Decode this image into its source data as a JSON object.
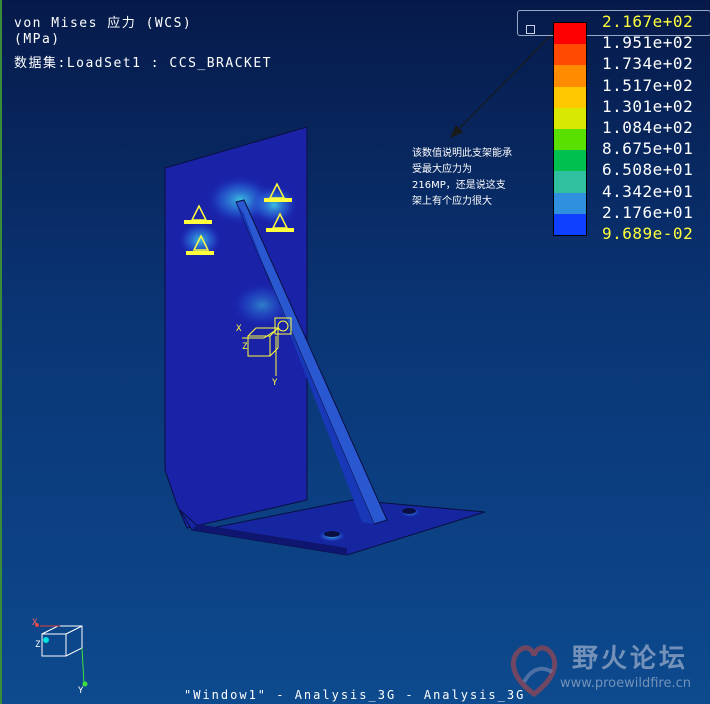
{
  "header": {
    "title": "von Mises 应力 (WCS)",
    "units": "(MPa)",
    "dataset": "数据集:LoadSet1 :  CCS_BRACKET"
  },
  "legend": {
    "values": [
      "2.167e+02",
      "1.951e+02",
      "1.734e+02",
      "1.517e+02",
      "1.301e+02",
      "1.084e+02",
      "8.675e+01",
      "6.508e+01",
      "4.342e+01",
      "2.176e+01",
      "9.689e-02"
    ],
    "colors": [
      "#ff0000",
      "#ff4a00",
      "#ff8c00",
      "#ffc800",
      "#d8e800",
      "#5ae000",
      "#00c050",
      "#30c0a0",
      "#3090e0",
      "#1040ff",
      "#101ca0"
    ]
  },
  "annotation": "该数值说明此支架能承受最大应力为216MP，还是说这支架上有个应力很大",
  "triad_main": {
    "x": "X",
    "y": "Y",
    "z": "Z"
  },
  "triad_corner": {
    "x": "X",
    "y": "Y",
    "z": "Z"
  },
  "footer": "\"Window1\" - Analysis_3G - Analysis_3G",
  "watermark": {
    "title": "野火论坛",
    "url": "www.proewildfire.cn"
  }
}
